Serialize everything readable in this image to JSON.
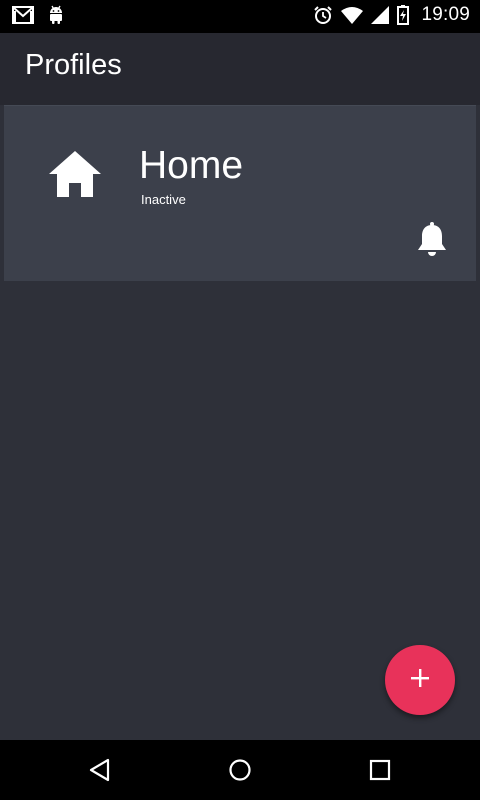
{
  "status_bar": {
    "time": "19:09",
    "icons": [
      "gmail-icon",
      "android-icon",
      "alarm-icon",
      "wifi-icon",
      "signal-icon",
      "battery-icon"
    ]
  },
  "toolbar": {
    "title": "Profiles"
  },
  "profiles": [
    {
      "name": "Home",
      "status": "Inactive",
      "icon": "home-icon",
      "action_icon": "bell-icon"
    }
  ],
  "fab": {
    "icon": "plus-icon",
    "color": "#e8325a"
  },
  "nav_bar": {
    "buttons": [
      "back-icon",
      "home-icon",
      "recents-icon"
    ]
  },
  "colors": {
    "background": "#2e3039",
    "toolbar": "#272830",
    "card": "#3c404b",
    "accent": "#e8325a"
  }
}
